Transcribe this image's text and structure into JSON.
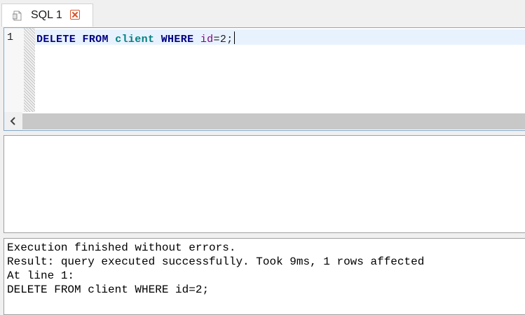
{
  "tab": {
    "label": "SQL 1",
    "icon": "document-icon",
    "close_icon": "close-icon"
  },
  "editor": {
    "line_number": "1",
    "tokens": {
      "delete": "DELETE",
      "from": "FROM",
      "table": "client",
      "where": "WHERE",
      "column": "id",
      "operator": "=",
      "value": "2;"
    },
    "colors": {
      "keyword": "#000080",
      "table": "#008080",
      "column": "#800080",
      "current_line": "#e8f2fe"
    }
  },
  "messages": {
    "line1": "Execution finished without errors.",
    "line2": "Result: query executed successfully. Took 9ms, 1 rows affected",
    "line3": "At line 1:",
    "line4": "DELETE FROM client WHERE id=2;"
  }
}
